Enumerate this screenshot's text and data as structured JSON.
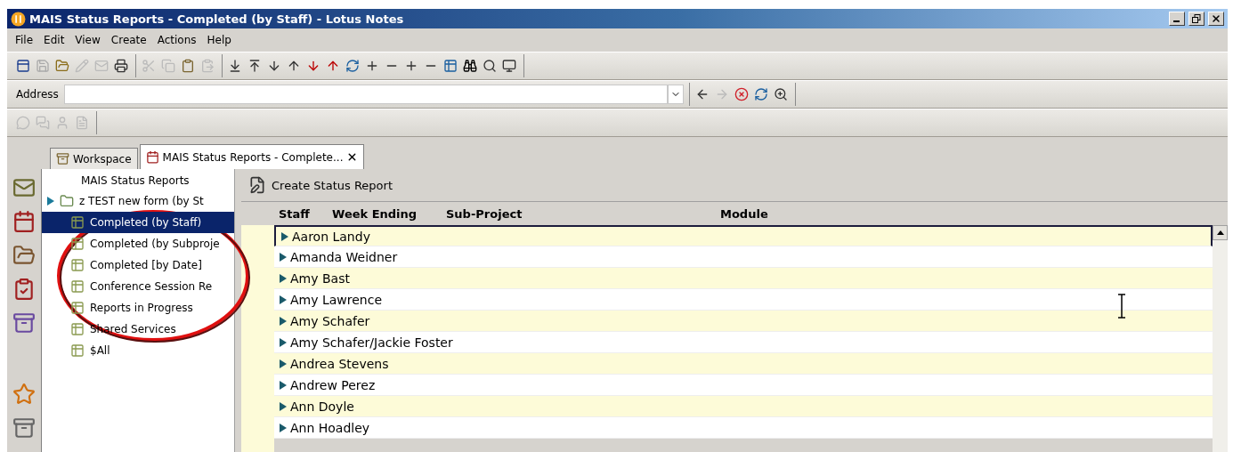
{
  "window": {
    "title": "MAIS Status Reports - Completed (by Staff) - Lotus Notes"
  },
  "menu": [
    "File",
    "Edit",
    "View",
    "Create",
    "Actions",
    "Help"
  ],
  "address": {
    "label": "Address"
  },
  "tabs": [
    {
      "label": "Workspace",
      "selected": false
    },
    {
      "label": "MAIS Status Reports - Complete...",
      "selected": true
    }
  ],
  "navigator": {
    "title": "MAIS Status Reports",
    "items": [
      {
        "label": "z TEST new form (by St",
        "kind": "folder",
        "selected": false
      },
      {
        "label": "Completed (by Staff)",
        "kind": "view",
        "selected": true
      },
      {
        "label": "Completed (by Subproje",
        "kind": "view",
        "selected": false
      },
      {
        "label": "Completed [by Date]",
        "kind": "view",
        "selected": false
      },
      {
        "label": "Conference Session Re",
        "kind": "view",
        "selected": false
      },
      {
        "label": "Reports in Progress",
        "kind": "view",
        "selected": false
      },
      {
        "label": "Shared Services",
        "kind": "view",
        "selected": false
      },
      {
        "label": "$All",
        "kind": "view",
        "selected": false
      }
    ]
  },
  "action_bar": {
    "button": "Create Status Report"
  },
  "table": {
    "columns": [
      "Staff",
      "Week Ending",
      "Sub-Project",
      "Module"
    ],
    "rows": [
      {
        "name": "Aaron Landy",
        "selected": true
      },
      {
        "name": "Amanda Weidner",
        "selected": false
      },
      {
        "name": "Amy Bast",
        "selected": false
      },
      {
        "name": "Amy Lawrence",
        "selected": false
      },
      {
        "name": "Amy Schafer",
        "selected": false
      },
      {
        "name": "Amy Schafer/Jackie Foster",
        "selected": false
      },
      {
        "name": "Andrea Stevens",
        "selected": false
      },
      {
        "name": "Andrew Perez",
        "selected": false
      },
      {
        "name": "Ann Doyle",
        "selected": false
      },
      {
        "name": "Ann Hoadley",
        "selected": false
      }
    ]
  }
}
